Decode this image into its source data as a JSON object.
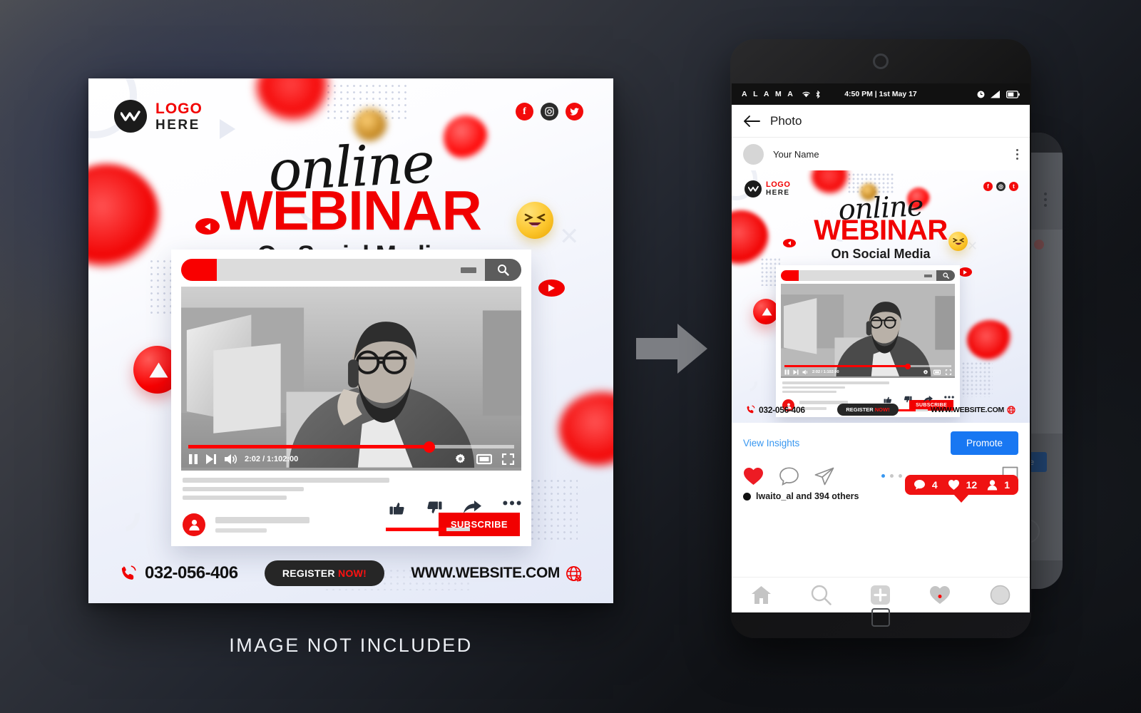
{
  "canvas": {
    "not_included_text": "IMAGE NOT INCLUDED"
  },
  "poster": {
    "logo": {
      "line1": "LOGO",
      "line2": "HERE",
      "icon": "wave-logo-icon"
    },
    "social": [
      {
        "name": "facebook-icon",
        "glyph": "f"
      },
      {
        "name": "instagram-icon",
        "glyph": "◎"
      },
      {
        "name": "twitter-icon",
        "glyph": "t"
      }
    ],
    "title_script": "online",
    "title_main": "WEBINAR",
    "title_sub": "On Social Media",
    "video_card": {
      "search_placeholder": "",
      "search_icon": "magnifier-icon",
      "time": "2:02 / 1:102:00",
      "progress_percent": 74,
      "controls": [
        "pause-icon",
        "next-icon",
        "volume-icon"
      ],
      "right_controls": [
        "settings-gear-icon",
        "theater-mode-icon",
        "fullscreen-icon"
      ],
      "actions": [
        "thumbs-up-icon",
        "thumbs-down-icon",
        "share-icon",
        "more-icon"
      ],
      "like_ratio_percent": 72,
      "subscribe_label": "SUBSCRIBE"
    },
    "footer": {
      "phone": "032-056-406",
      "phone_icon": "phone-ring-icon",
      "register_text": "REGISTER",
      "register_accent": "NOW!",
      "website": "WWW.WEBSITE.COM",
      "globe_icon": "globe-icon"
    },
    "accent_red": "#f10000",
    "dark": "#1c1c1c"
  },
  "arrow": {
    "name": "right-arrow-icon"
  },
  "phone": {
    "status_bar": {
      "carrier": "A L A M A",
      "wifi_icon": "wifi-icon",
      "bluetooth_icon": "bluetooth-icon",
      "time": "4:50 PM | 1st May 17",
      "clock_icon": "alarm-icon",
      "signal_icon": "signal-icon",
      "battery_icon": "battery-icon"
    },
    "appbar": {
      "back_icon": "back-arrow-icon",
      "title": "Photo"
    },
    "post_header": {
      "avatar": "user-avatar",
      "username": "Your Name",
      "menu_icon": "kebab-menu-icon"
    },
    "insights": {
      "link": "View Insights",
      "promote_label": "Promote"
    },
    "ig_actions": {
      "like_icon": "heart-filled-icon",
      "comment_icon": "comment-icon",
      "share_icon": "send-icon",
      "bookmark_icon": "bookmark-icon",
      "pagination": [
        true,
        false,
        false
      ]
    },
    "badge": {
      "comments": "4",
      "likes": "12",
      "followers": "1",
      "comment_icon": "comment-bubble-icon",
      "like_icon": "heart-icon",
      "follower_icon": "person-icon"
    },
    "liked_by": "lwaito_al  and 394 others",
    "tabbar": [
      {
        "name": "tab-home",
        "icon": "home-icon"
      },
      {
        "name": "tab-search",
        "icon": "search-icon"
      },
      {
        "name": "tab-add",
        "icon": "plus-square-icon"
      },
      {
        "name": "tab-activity",
        "icon": "heart-icon"
      },
      {
        "name": "tab-profile",
        "icon": "profile-circle-icon"
      }
    ],
    "promote_blue": "#1877f2",
    "link_blue": "#3897f0"
  }
}
